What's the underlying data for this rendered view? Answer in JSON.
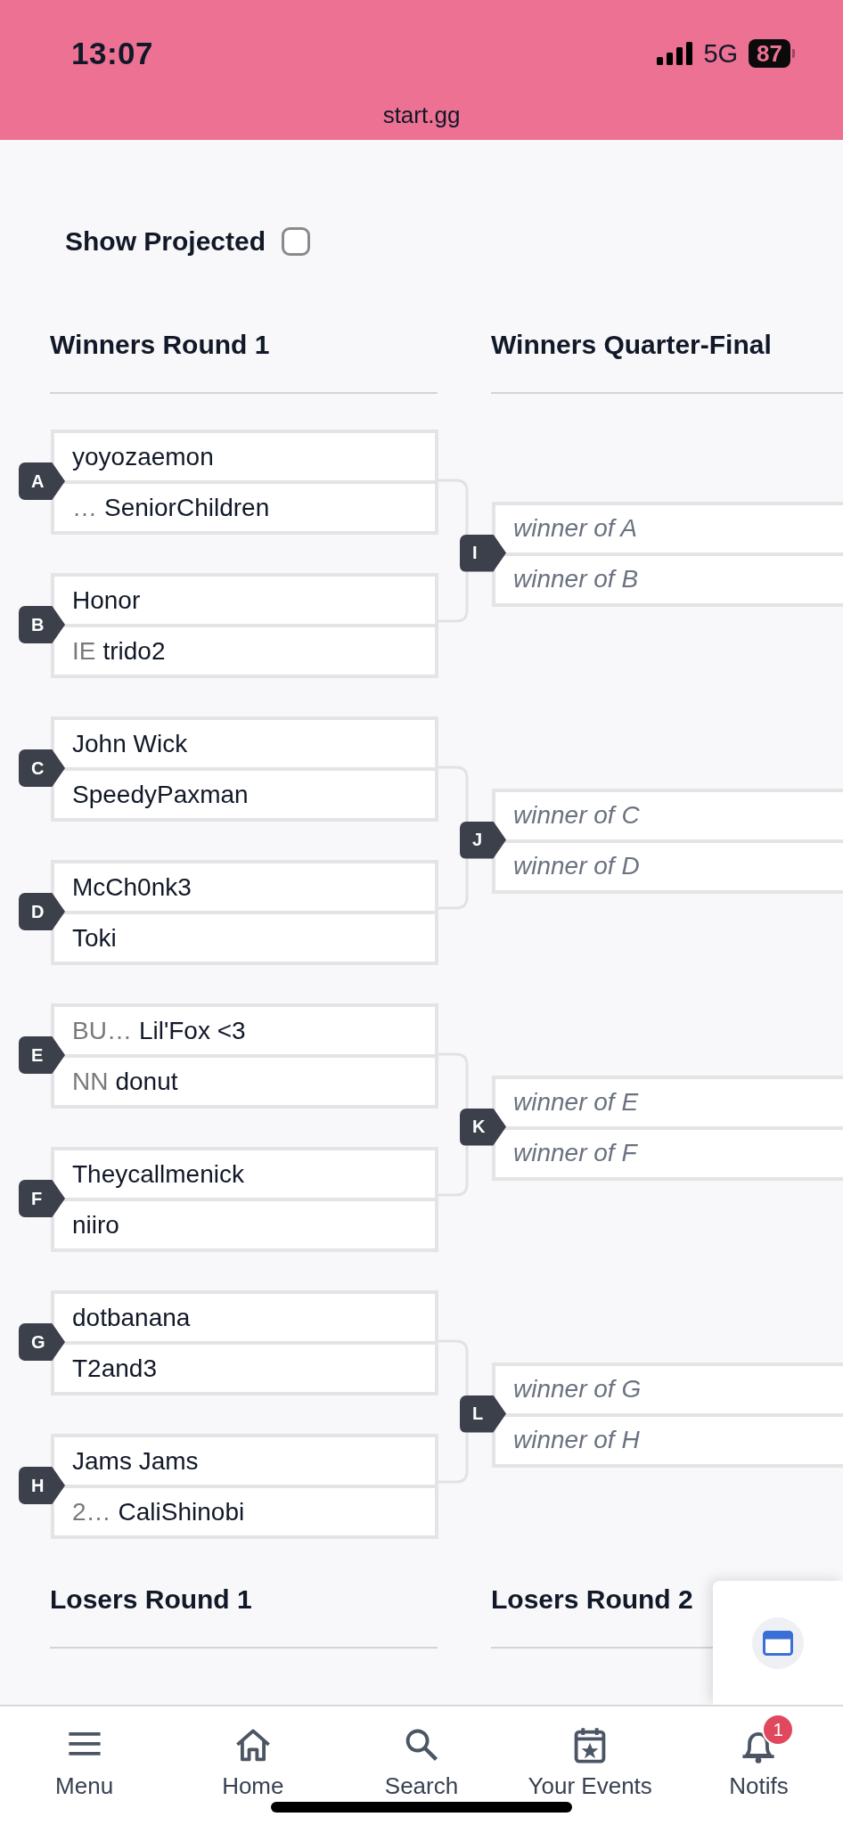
{
  "status_bar": {
    "time": "13:07",
    "network": "5G",
    "battery": "87"
  },
  "address_bar": {
    "url": "start.gg"
  },
  "show_projected": {
    "label": "Show Projected",
    "checked": false
  },
  "winners_rounds": [
    {
      "title": "Winners Round 1"
    },
    {
      "title": "Winners Quarter-Final"
    }
  ],
  "pairs": [
    {
      "matches": [
        {
          "id": "A",
          "slots": [
            {
              "kind": "player",
              "name": "yoyozaemon"
            },
            {
              "kind": "player",
              "prefix": "…",
              "name": "SeniorChildren"
            }
          ]
        },
        {
          "id": "B",
          "slots": [
            {
              "kind": "player",
              "name": "Honor"
            },
            {
              "kind": "player",
              "prefix": "IE",
              "name": "trido2"
            }
          ]
        }
      ],
      "next": {
        "id": "I",
        "slots": [
          {
            "kind": "pending",
            "name": "winner of A"
          },
          {
            "kind": "pending",
            "name": "winner of B"
          }
        ]
      }
    },
    {
      "matches": [
        {
          "id": "C",
          "slots": [
            {
              "kind": "player",
              "name": "John Wick"
            },
            {
              "kind": "player",
              "name": "SpeedyPaxman"
            }
          ]
        },
        {
          "id": "D",
          "slots": [
            {
              "kind": "player",
              "name": "McCh0nk3"
            },
            {
              "kind": "player",
              "name": "Toki"
            }
          ]
        }
      ],
      "next": {
        "id": "J",
        "slots": [
          {
            "kind": "pending",
            "name": "winner of C"
          },
          {
            "kind": "pending",
            "name": "winner of D"
          }
        ]
      }
    },
    {
      "matches": [
        {
          "id": "E",
          "slots": [
            {
              "kind": "player",
              "prefix": "BU…",
              "name": "Lil'Fox <3"
            },
            {
              "kind": "player",
              "prefix": "NN",
              "name": "donut"
            }
          ]
        },
        {
          "id": "F",
          "slots": [
            {
              "kind": "player",
              "name": "Theycallmenick"
            },
            {
              "kind": "player",
              "name": "niiro"
            }
          ]
        }
      ],
      "next": {
        "id": "K",
        "slots": [
          {
            "kind": "pending",
            "name": "winner of E"
          },
          {
            "kind": "pending",
            "name": "winner of F"
          }
        ]
      }
    },
    {
      "matches": [
        {
          "id": "G",
          "slots": [
            {
              "kind": "player",
              "name": "dotbanana"
            },
            {
              "kind": "player",
              "name": "T2and3"
            }
          ]
        },
        {
          "id": "H",
          "slots": [
            {
              "kind": "player",
              "name": "Jams Jams"
            },
            {
              "kind": "player",
              "prefix": "2…",
              "name": "CaliShinobi"
            }
          ]
        }
      ],
      "next": {
        "id": "L",
        "slots": [
          {
            "kind": "pending",
            "name": "winner of G"
          },
          {
            "kind": "pending",
            "name": "winner of H"
          }
        ]
      }
    }
  ],
  "losers_rounds": [
    {
      "title": "Losers Round 1"
    },
    {
      "title": "Losers Round 2"
    }
  ],
  "nav": [
    {
      "label": "Menu"
    },
    {
      "label": "Home"
    },
    {
      "label": "Search"
    },
    {
      "label": "Your Events"
    },
    {
      "label": "Notifs",
      "count": "1"
    }
  ]
}
